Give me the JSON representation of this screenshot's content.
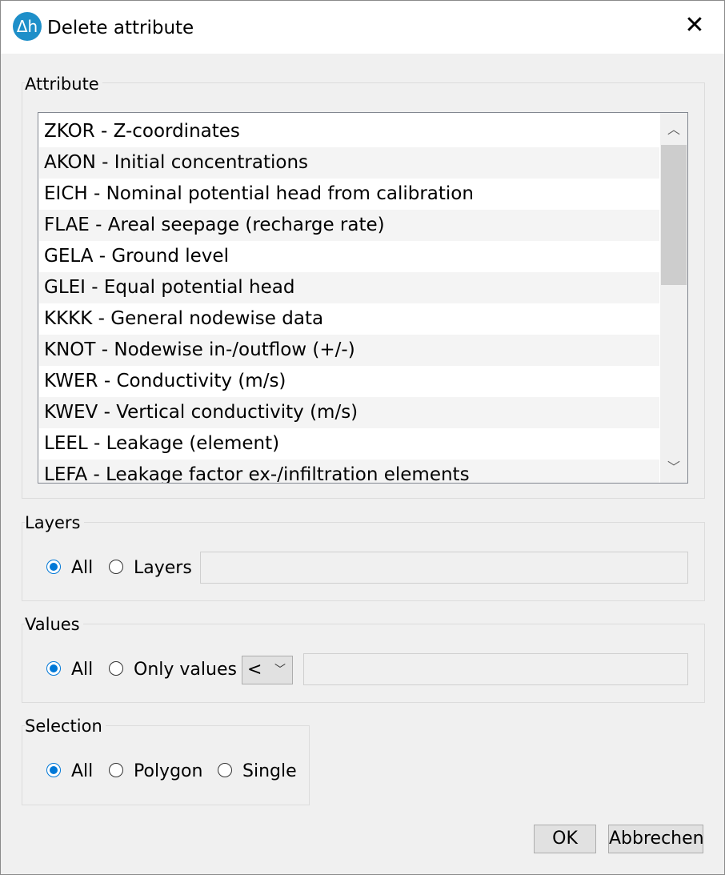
{
  "titlebar": {
    "icon_text": "Δh",
    "title": "Delete attribute",
    "close_glyph": "✕"
  },
  "attribute_group": {
    "label": "Attribute",
    "items": [
      "ZKOR - Z-coordinates",
      "AKON - Initial concentrations",
      "EICH - Nominal potential head from calibration",
      "FLAE - Areal seepage (recharge rate)",
      "GELA - Ground level",
      "GLEI - Equal potential head",
      "KKKK - General nodewise data",
      "KNOT - Nodewise in-/outflow (+/-)",
      "KWER - Conductivity (m/s)",
      "KWEV - Vertical conductivity (m/s)",
      "LEEL - Leakage (element)",
      "LEFA - Leakage factor ex-/infiltration elements"
    ]
  },
  "layers_group": {
    "label": "Layers",
    "option_all": "All",
    "option_layers": "Layers",
    "layers_value": ""
  },
  "values_group": {
    "label": "Values",
    "option_all": "All",
    "option_only_values": "Only values",
    "operator": "<",
    "value": ""
  },
  "selection_group": {
    "label": "Selection",
    "option_all": "All",
    "option_polygon": "Polygon",
    "option_single": "Single"
  },
  "buttons": {
    "ok": "OK",
    "cancel": "Abbrechen"
  },
  "colors": {
    "accent": "#0078d7",
    "app_icon": "#1e8fc9"
  }
}
